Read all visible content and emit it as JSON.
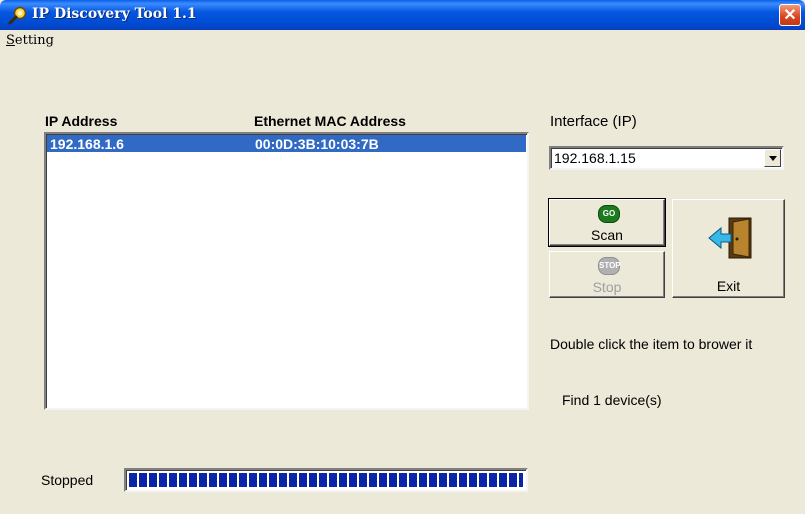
{
  "window": {
    "title": "IP Discovery Tool 1.1",
    "close_label": "✕"
  },
  "menu": {
    "setting_label": "Setting"
  },
  "device_list": {
    "columns": [
      "IP Address",
      "Ethernet MAC Address"
    ],
    "rows": [
      {
        "ip": "192.168.1.6",
        "mac": "00:0D:3B:10:03:7B"
      }
    ]
  },
  "interface": {
    "label": "Interface (IP)",
    "selected": "192.168.1.15"
  },
  "buttons": {
    "scan_label": "Scan",
    "scan_badge": "GO",
    "stop_label": "Stop",
    "stop_badge": "STOP",
    "exit_label": "Exit"
  },
  "hint_text": "Double click the item to brower it",
  "found_text": "Find 1 device(s)",
  "status": {
    "label": "Stopped",
    "progress": 1.0
  },
  "colors": {
    "selection": "#316ac5",
    "progress": "#0a24a8",
    "go_badge": "#1e7a1e",
    "stop_badge": "#b0b0b0"
  }
}
